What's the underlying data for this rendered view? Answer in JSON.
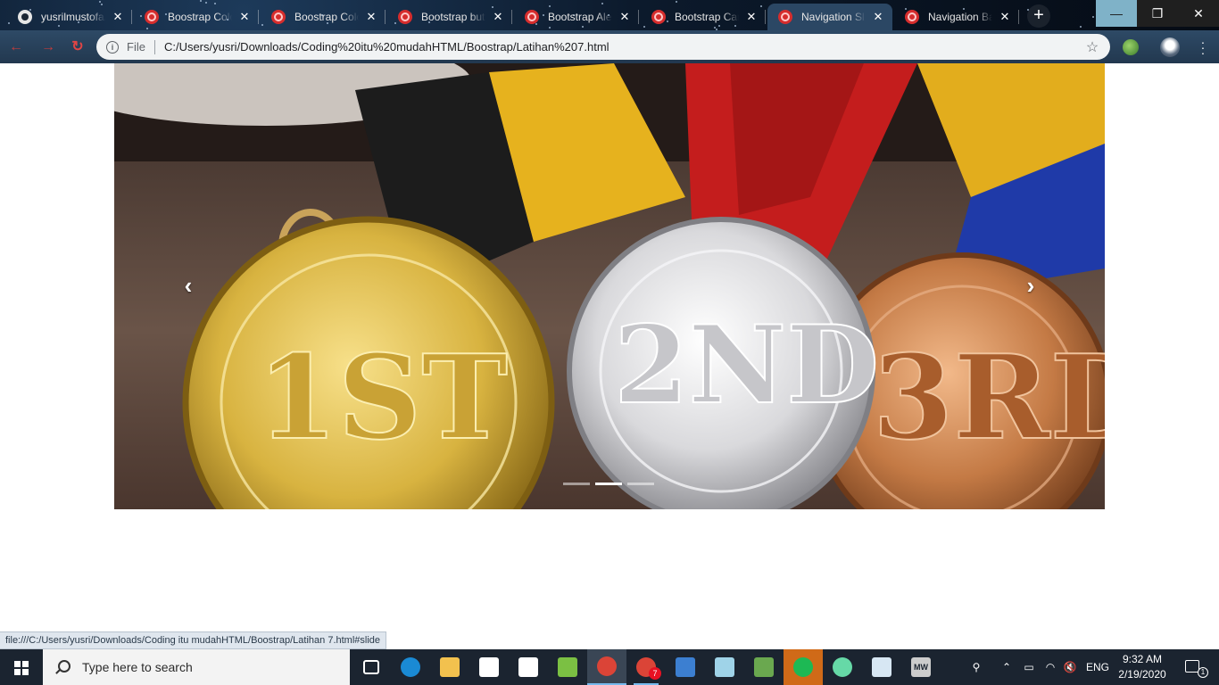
{
  "browser": {
    "tabs": [
      {
        "title": "yusrilmustofa/",
        "favicon": "github-icon"
      },
      {
        "title": "Boostrap Colo",
        "favicon": "bootstrap-icon"
      },
      {
        "title": "Boostrap Colo",
        "favicon": "bootstrap-icon"
      },
      {
        "title": "Bootstrap butt",
        "favicon": "bootstrap-icon"
      },
      {
        "title": "Bootstrap Aler",
        "favicon": "bootstrap-icon"
      },
      {
        "title": "Bootstrap Card",
        "favicon": "bootstrap-icon"
      },
      {
        "title": "Navigation Sl",
        "favicon": "bootstrap-icon",
        "active": true
      },
      {
        "title": "Navigation Ba",
        "favicon": "bootstrap-icon"
      }
    ],
    "tab_close_glyph": "✕",
    "new_tab_glyph": "+",
    "window": {
      "minimize": "—",
      "maximize": "❐",
      "close": "✕"
    },
    "address": {
      "scheme_label": "File",
      "url": "C:/Users/yusri/Downloads/Coding%20itu%20mudahHTML/Boostrap/Latihan%207.html"
    }
  },
  "page": {
    "carousel": {
      "image": "medals-1st-2nd-3rd",
      "medal_labels": {
        "gold": "1ST",
        "silver": "2ND",
        "bronze": "3RD"
      },
      "prev_glyph": "‹",
      "next_glyph": "›",
      "slide_count": 3,
      "active_index": 1
    },
    "status_url": "file:///C:/Users/yusri/Downloads/Coding itu mudahHTML/Boostrap/Latihan 7.html#slide"
  },
  "taskbar": {
    "search_placeholder": "Type here to search",
    "apps": [
      {
        "name": "task-view-icon",
        "color": "#ffffff"
      },
      {
        "name": "edge-icon",
        "color": "#1a8ad4"
      },
      {
        "name": "file-explorer-icon",
        "color": "#f2c14e"
      },
      {
        "name": "store-icon",
        "color": "#ffffff"
      },
      {
        "name": "visual-studio-icon",
        "color": "#ffffff"
      },
      {
        "name": "spreadsheet-icon",
        "color": "#7bc043"
      },
      {
        "name": "chrome-icon",
        "color": "#db4437",
        "active": true
      },
      {
        "name": "chrome-badge-icon",
        "color": "#db4437",
        "badge": "7",
        "open": true
      },
      {
        "name": "xampp-icon",
        "color": "#3c7fd1"
      },
      {
        "name": "notepad-icon",
        "color": "#9fd3e8"
      },
      {
        "name": "sublime-icon",
        "color": "#6aa84f"
      },
      {
        "name": "spotify-icon",
        "color": "#1db954",
        "highlight": "#d06a18"
      },
      {
        "name": "atom-icon",
        "color": "#66d9a7"
      },
      {
        "name": "window-app-icon",
        "color": "#d7e7f3"
      },
      {
        "name": "mw-app-icon",
        "color": "#cccccc",
        "label": "MW"
      }
    ],
    "tray": {
      "language": "ENG",
      "time": "9:32 AM",
      "date": "2/19/2020",
      "notifications": "1"
    }
  }
}
